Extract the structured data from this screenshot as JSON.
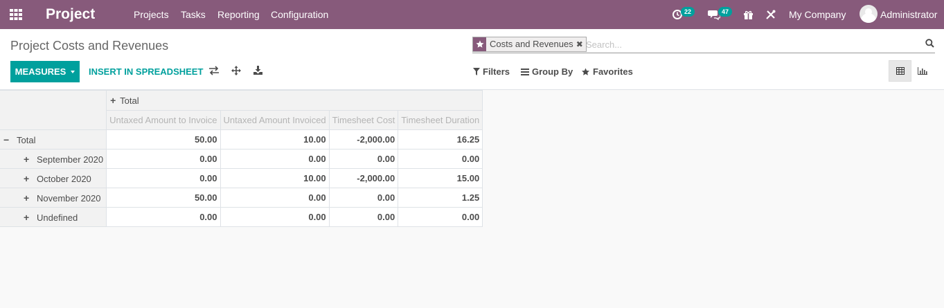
{
  "navbar": {
    "brand": "Project",
    "menu": [
      "Projects",
      "Tasks",
      "Reporting",
      "Configuration"
    ],
    "activity_count": "22",
    "messages_count": "47",
    "company": "My Company",
    "user": "Administrator",
    "color": "#875a7b"
  },
  "page": {
    "title": "Project Costs and Revenues"
  },
  "search": {
    "facet_label": "Costs and Revenues",
    "placeholder": "Search..."
  },
  "toolbar": {
    "measures_label": "MEASURES",
    "insert_label": "INSERT IN SPREADSHEET",
    "filters_label": "Filters",
    "groupby_label": "Group By",
    "favorites_label": "Favorites",
    "accent": "#00a09d"
  },
  "pivot": {
    "col_header": "Total",
    "measures": [
      "Untaxed Amount to Invoice",
      "Untaxed Amount Invoiced",
      "Timesheet Cost",
      "Timesheet Duration"
    ],
    "rows": [
      {
        "label": "Total",
        "values": [
          "50.00",
          "10.00",
          "-2,000.00",
          "16.25"
        ]
      },
      {
        "label": "September 2020",
        "values": [
          "0.00",
          "0.00",
          "0.00",
          "0.00"
        ]
      },
      {
        "label": "October 2020",
        "values": [
          "0.00",
          "10.00",
          "-2,000.00",
          "15.00"
        ]
      },
      {
        "label": "November 2020",
        "values": [
          "50.00",
          "0.00",
          "0.00",
          "1.25"
        ]
      },
      {
        "label": "Undefined",
        "values": [
          "0.00",
          "0.00",
          "0.00",
          "0.00"
        ]
      }
    ]
  }
}
